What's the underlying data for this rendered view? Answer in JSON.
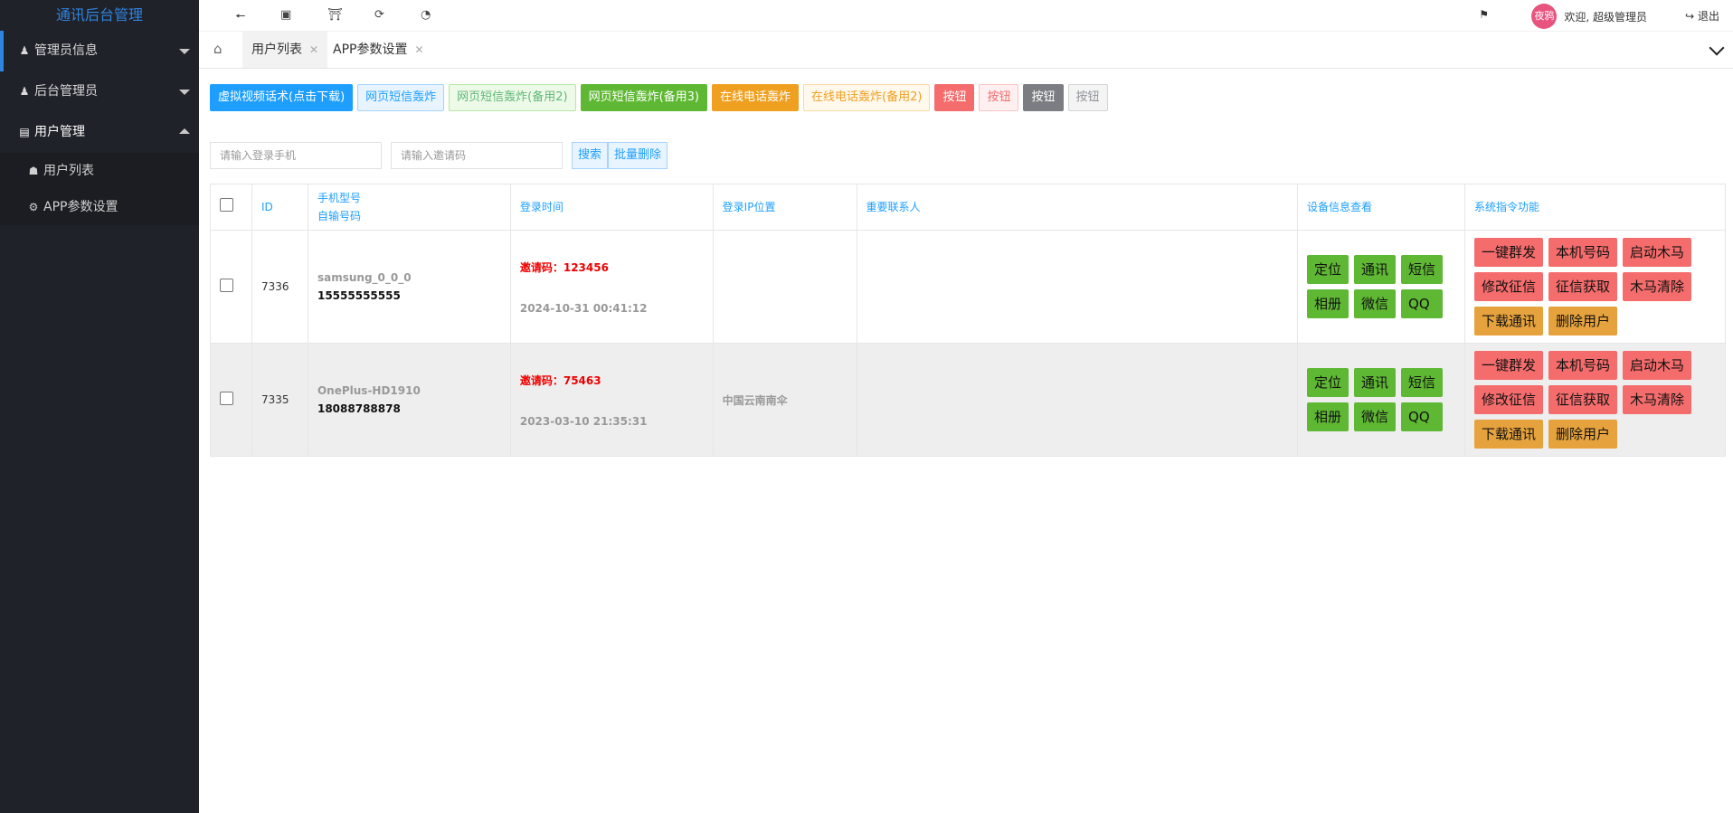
{
  "app": {
    "title": "通讯后台管理"
  },
  "sidebar": {
    "groups": [
      {
        "label": "管理员信息",
        "icon": "user-icon"
      },
      {
        "label": "后台管理员",
        "icon": "user-icon"
      },
      {
        "label": "用户管理",
        "icon": "id-card-icon"
      }
    ],
    "subitems": [
      {
        "label": "用户列表",
        "icon": "lock-icon"
      },
      {
        "label": "APP参数设置",
        "icon": "gear-icon"
      }
    ]
  },
  "topbar": {
    "icons": [
      "back-icon",
      "fullscreen-icon",
      "bank-icon",
      "refresh-icon",
      "theme-icon"
    ],
    "avatar_text": "夜鸦",
    "welcome": "欢迎, 超级管理员",
    "logout": "退出"
  },
  "tabs": [
    {
      "label": "用户列表",
      "active": true
    },
    {
      "label": "APP参数设置",
      "active": false
    }
  ],
  "actions": [
    "虚拟视频话术(点击下载)",
    "网页短信轰炸",
    "网页短信轰炸(备用2)",
    "网页短信轰炸(备用3)",
    "在线电话轰炸",
    "在线电话轰炸(备用2)",
    "按钮",
    "按钮",
    "按钮",
    "按钮"
  ],
  "search": {
    "phone_placeholder": "请输入登录手机",
    "code_placeholder": "请输入邀请码",
    "search_label": "搜索",
    "batch_delete_label": "批量删除"
  },
  "table": {
    "headers": {
      "id": "ID",
      "model_line1": "手机型号",
      "model_line2": "自输号码",
      "login_time": "登录时间",
      "login_ip": "登录IP位置",
      "contacts": "重要联系人",
      "device": "设备信息查看",
      "system": "系统指令功能"
    },
    "device_buttons": [
      "定位",
      "通讯",
      "短信",
      "相册",
      "微信",
      "QQ"
    ],
    "system_buttons": [
      "一键群发",
      "本机号码",
      "启动木马",
      "修改征信",
      "征信获取",
      "木马清除",
      "下载通讯",
      "删除用户"
    ],
    "rows": [
      {
        "id": "7336",
        "model": "samsung_0_0_0",
        "phone": "15555555555",
        "invite": "邀请码：123456",
        "time": "2024-10-31 00:41:12",
        "ip": "",
        "contacts": ""
      },
      {
        "id": "7335",
        "model": "OnePlus-HD1910",
        "phone": "18088788878",
        "invite": "邀请码：75463",
        "time": "2023-03-10 21:35:31",
        "ip": "中国云南南伞",
        "contacts": ""
      }
    ]
  }
}
